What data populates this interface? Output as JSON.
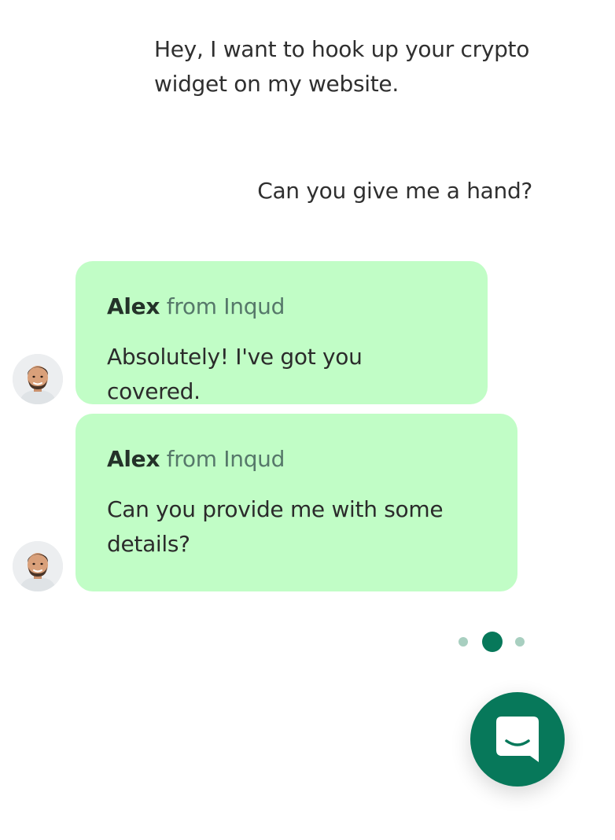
{
  "conversation": {
    "user_messages": [
      {
        "text": "Hey, I want to hook up your crypto widget on my website."
      },
      {
        "text": "Can you give me a hand?"
      }
    ],
    "agent_messages": [
      {
        "sender_name": "Alex",
        "sender_org": "from Inqud",
        "text": "Absolutely! I've got you covered."
      },
      {
        "sender_name": "Alex",
        "sender_org": "from Inqud",
        "text": "Can you provide me with some details?"
      }
    ]
  },
  "carousel": {
    "total_slides": 3,
    "active_slide": 2
  },
  "launcher": {
    "icon": "chat-icon"
  },
  "colors": {
    "agent_bubble": "#c1fdc6",
    "accent": "#07785a",
    "inactive_dot": "#a8cfc0",
    "sender_org_text": "#56786a"
  }
}
